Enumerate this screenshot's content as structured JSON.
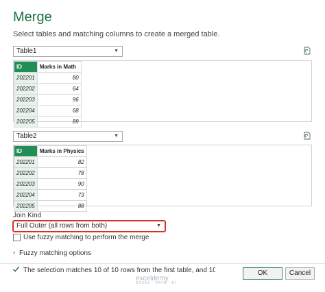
{
  "dialog": {
    "title": "Merge",
    "subtitle": "Select tables and matching columns to create a merged table."
  },
  "table1": {
    "select_value": "Table1",
    "headers": [
      "ID",
      "Marks in Math"
    ],
    "rows": [
      [
        "202201",
        "80"
      ],
      [
        "202202",
        "64"
      ],
      [
        "202203",
        "96"
      ],
      [
        "202204",
        "68"
      ],
      [
        "202205",
        "89"
      ]
    ]
  },
  "table2": {
    "select_value": "Table2",
    "headers": [
      "ID",
      "Marks in Physics"
    ],
    "rows": [
      [
        "202201",
        "82"
      ],
      [
        "202202",
        "78"
      ],
      [
        "202203",
        "90"
      ],
      [
        "202204",
        "73"
      ],
      [
        "202205",
        "88"
      ]
    ]
  },
  "join": {
    "label": "Join Kind",
    "value": "Full Outer (all rows from both)"
  },
  "fuzzy": {
    "checkbox_label": "Use fuzzy matching to perform the merge",
    "options_label": "Fuzzy matching options"
  },
  "status": {
    "message": "The selection matches 10 of 10 rows from the first table, and 10 of 10 row..."
  },
  "buttons": {
    "ok": "OK",
    "cancel": "Cancel"
  },
  "watermark": {
    "brand": "exceldemy",
    "tagline": "EXCEL · DATA · BI"
  },
  "colors": {
    "accent_green": "#217346",
    "highlight_red": "#d93025"
  }
}
